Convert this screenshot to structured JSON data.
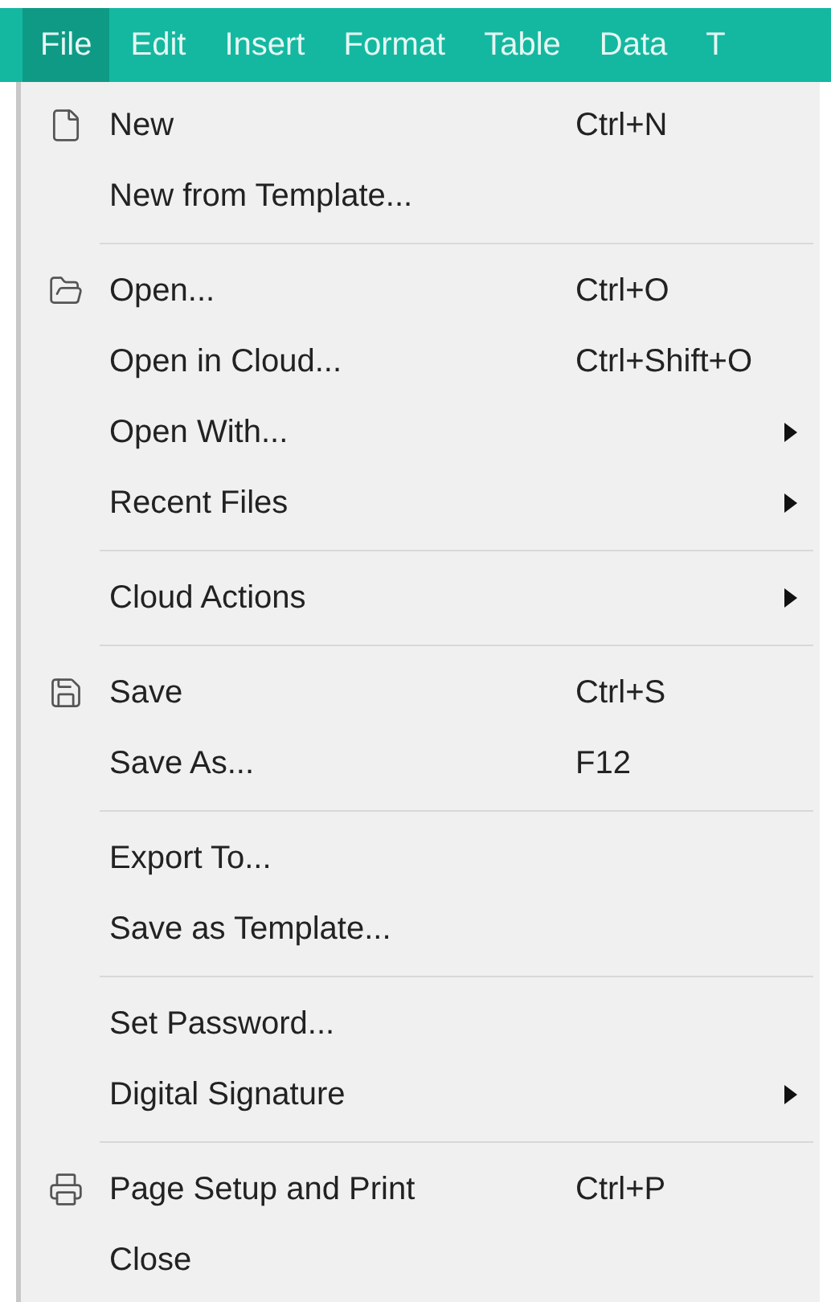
{
  "menu_bar": [
    {
      "label": "File",
      "selected": true
    },
    {
      "label": "Edit",
      "selected": false
    },
    {
      "label": "Insert",
      "selected": false
    },
    {
      "label": "Format",
      "selected": false
    },
    {
      "label": "Table",
      "selected": false
    },
    {
      "label": "Data",
      "selected": false
    },
    {
      "label": "T",
      "selected": false
    }
  ],
  "file_menu": [
    [
      {
        "label": "New",
        "shortcut": "Ctrl+N",
        "icon": true
      },
      {
        "label": "New from Template..."
      }
    ],
    [
      {
        "label": "Open...",
        "shortcut": "Ctrl+O",
        "icon": true
      },
      {
        "label": "Open in Cloud...",
        "shortcut": "Ctrl+Shift+O"
      },
      {
        "label": "Open With...",
        "submenu": true
      },
      {
        "label": "Recent Files",
        "submenu": true
      }
    ],
    [
      {
        "label": "Cloud Actions",
        "submenu": true
      }
    ],
    [
      {
        "label": "Save",
        "shortcut": "Ctrl+S",
        "icon": true
      },
      {
        "label": "Save As...",
        "shortcut": "F12"
      }
    ],
    [
      {
        "label": "Export To..."
      },
      {
        "label": "Save as Template..."
      }
    ],
    [
      {
        "label": "Set Password..."
      },
      {
        "label": "Digital Signature",
        "submenu": true
      }
    ],
    [
      {
        "label": "Page Setup and Print",
        "shortcut": "Ctrl+P",
        "icon": true
      },
      {
        "label": "Close"
      }
    ]
  ]
}
